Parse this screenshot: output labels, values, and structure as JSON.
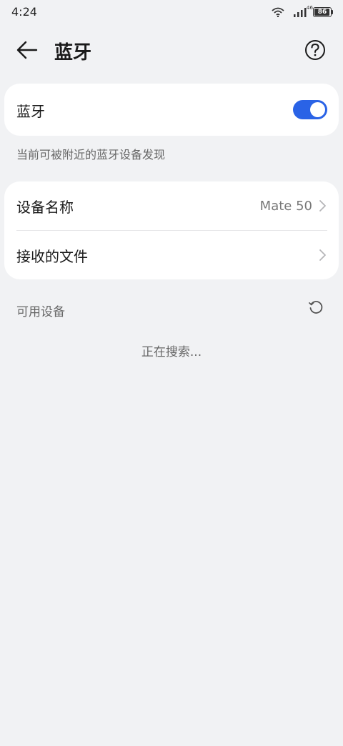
{
  "status_bar": {
    "time": "4:24",
    "network_label": "46",
    "battery_level": "86",
    "icons": [
      "wifi-icon",
      "cellular-signal-icon",
      "battery-icon"
    ]
  },
  "header": {
    "title": "蓝牙",
    "back_icon": "arrow-left-icon",
    "help_icon": "question-circle-icon"
  },
  "bluetooth_card": {
    "label": "蓝牙",
    "toggle_on": true
  },
  "hint": "当前可被附近的蓝牙设备发现",
  "settings_card": {
    "items": [
      {
        "label": "设备名称",
        "value": "Mate 50"
      },
      {
        "label": "接收的文件",
        "value": ""
      }
    ]
  },
  "available_devices": {
    "title": "可用设备",
    "refresh_icon": "refresh-icon",
    "status": "正在搜索..."
  },
  "colors": {
    "background": "#f1f2f4",
    "card": "#ffffff",
    "accent": "#2a63e6"
  }
}
